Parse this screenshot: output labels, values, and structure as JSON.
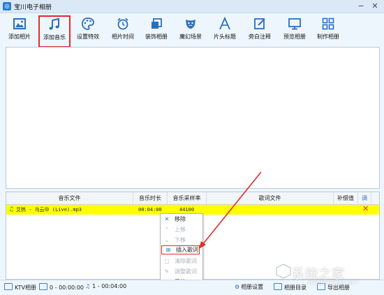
{
  "window": {
    "title": "宝川电子相册",
    "controls": {
      "minimize": "−",
      "close": "✕"
    }
  },
  "toolbar": {
    "items": [
      {
        "label": "添加相片",
        "icon": "image-icon"
      },
      {
        "label": "添加音乐",
        "icon": "music-note-icon",
        "active": true
      },
      {
        "label": "设置特效",
        "icon": "palette-icon"
      },
      {
        "label": "相片时间",
        "icon": "alarm-clock-icon"
      },
      {
        "label": "装饰相册",
        "icon": "stacked-squares-icon"
      },
      {
        "label": "魔幻场景",
        "icon": "theater-mask-icon"
      },
      {
        "label": "片头标题",
        "icon": "letter-a-icon"
      },
      {
        "label": "旁白注释",
        "icon": "edit-icon"
      },
      {
        "label": "预览相册",
        "icon": "monitor-icon"
      },
      {
        "label": "制作相册",
        "icon": "grid-icon"
      }
    ]
  },
  "music_table": {
    "columns": [
      "音乐文件",
      "音乐时长",
      "音乐采样率",
      "歌词文件",
      "补偿值",
      "调"
    ],
    "rows": [
      {
        "file": "艾热 - 乌云中 (Live).mp3",
        "duration": "00:04:00",
        "sample_rate": "44100",
        "lyrics": "",
        "offset": ""
      }
    ],
    "row_color": "#ffff00"
  },
  "context_menu": {
    "items": [
      {
        "label": "移除",
        "icon": "x-icon",
        "enabled": true
      },
      {
        "label": "上移",
        "icon": "chevron-up-icon",
        "enabled": false
      },
      {
        "label": "下移",
        "icon": "chevron-down-icon",
        "enabled": false
      },
      {
        "label": "插入歌词",
        "icon": "insert-lyrics-icon",
        "enabled": true,
        "highlighted": true
      },
      {
        "label": "清除歌词",
        "icon": "clear-lyrics-icon",
        "enabled": false
      },
      {
        "label": "调整歌词",
        "icon": "adjust-lyrics-icon",
        "enabled": false
      },
      {
        "label": "属性",
        "icon": "more-icon",
        "enabled": true
      }
    ]
  },
  "statusbar": {
    "ktv": "KTV相册",
    "photos": "0 - 00:00:00",
    "music": "1 - 00:04:00",
    "album_settings": "相册设置",
    "album_dir": "相册目录",
    "export": "导出相册"
  },
  "watermark": {
    "text": "系统之家",
    "url": "XITONGZHIJIA.NET"
  },
  "colors": {
    "accent": "#2c7fd4",
    "highlight": "#e02b2b",
    "row": "#ffff00"
  }
}
